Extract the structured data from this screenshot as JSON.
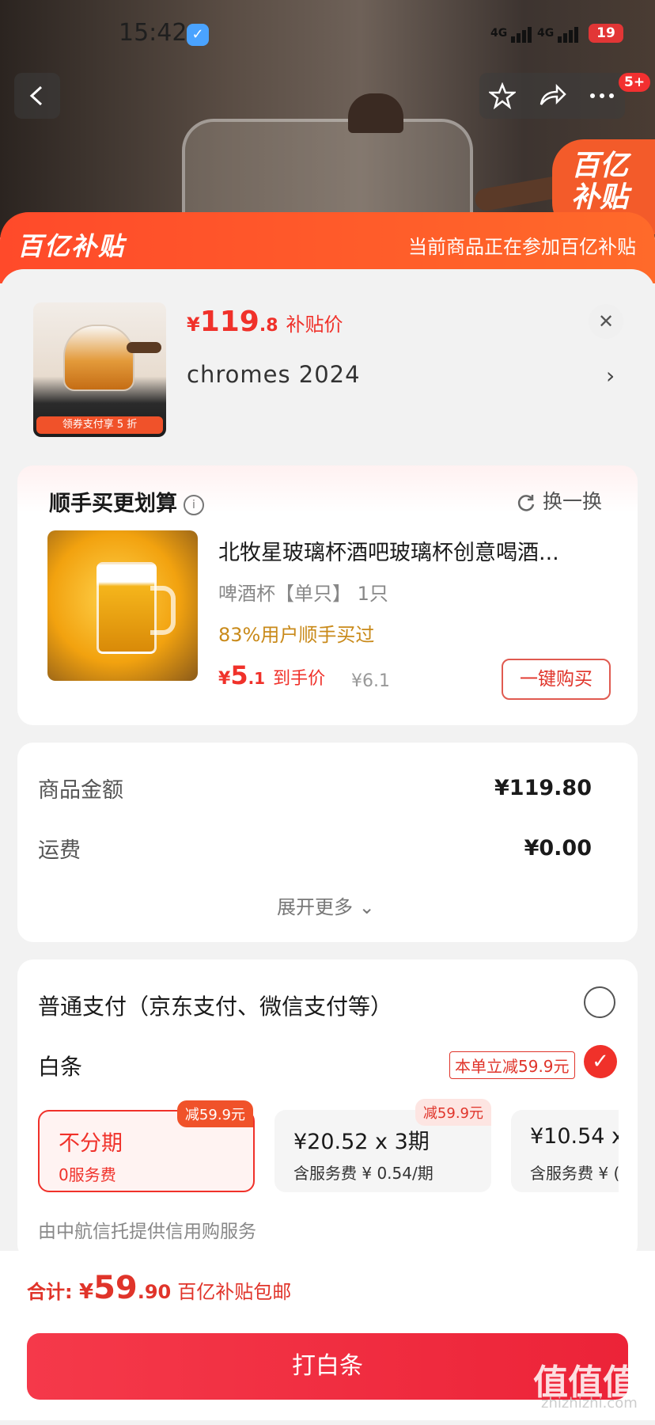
{
  "status_bar": {
    "time": "15:42",
    "net1": "4G",
    "net2": "4G",
    "battery": "19"
  },
  "nav": {
    "badge": "5+"
  },
  "hero": {
    "stamp_line1": "百亿",
    "stamp_line2": "补贴"
  },
  "banner": {
    "logo": "百亿补贴",
    "note": "当前商品正在参加百亿补贴"
  },
  "product": {
    "price_currency": "¥",
    "price_int": "119",
    "price_dec": ".8",
    "price_label": "补贴价",
    "name": "chromes  2024",
    "thumb_promo": "领券支付享 5 折"
  },
  "bundle": {
    "title": "顺手买更划算",
    "info_icon": "i",
    "swap_label": "换一换",
    "item_title": "北牧星玻璃杯酒吧玻璃杯创意喝酒...",
    "item_spec": "啤酒杯【单只】 1只",
    "item_rate": "83%用户顺手买过",
    "price_currency": "¥",
    "price_int": "5",
    "price_dec": ".1",
    "price_label": "到手价",
    "orig_price": "¥6.1",
    "buy_label": "一键购买"
  },
  "amount": {
    "rows": [
      {
        "label": "商品金额",
        "value": "¥119.80"
      },
      {
        "label": "运费",
        "value": "¥0.00"
      }
    ],
    "expand_label": "展开更多"
  },
  "payment": {
    "normal_label": "普通支付（京东支付、微信支付等）",
    "baitiao_label": "白条",
    "discount_tag": "本单立减59.9元",
    "plans": [
      {
        "title": "不分期",
        "sub": "0服务费",
        "tag": "减59.9元"
      },
      {
        "title": "¥20.52 x 3期",
        "sub": "含服务费 ¥ 0.54/期",
        "tag": "减59.9元"
      },
      {
        "title": "¥10.54 x",
        "sub": "含服务费 ¥ (",
        "tag": ""
      }
    ],
    "credit_note": "由中航信托提供信用购服务"
  },
  "footer": {
    "total_label": "合计:",
    "currency": "¥",
    "total_int": "59",
    "total_dec": ".90",
    "total_note": "百亿补贴包邮",
    "pay_button": "打白条"
  },
  "watermark": {
    "main": "值值值",
    "sub": "zhizhizhi.com"
  },
  "colors": {
    "accent": "#f0312a",
    "banner": "#ff5a2a",
    "rate": "#c98a1a"
  }
}
